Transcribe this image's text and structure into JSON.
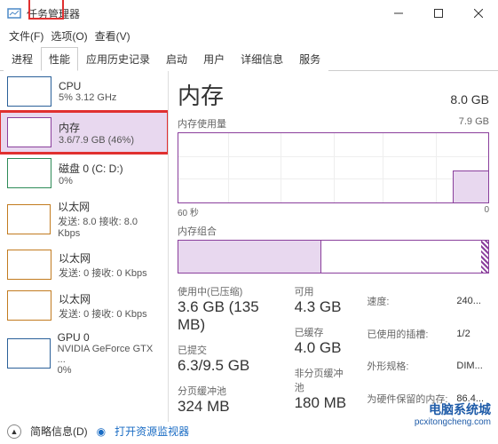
{
  "window": {
    "title": "任务管理器",
    "menu": {
      "file": "文件(F)",
      "options": "选项(O)",
      "view": "查看(V)"
    },
    "controls": {
      "min": "–",
      "max": "□",
      "close": "×"
    }
  },
  "tabs": [
    "进程",
    "性能",
    "应用历史记录",
    "启动",
    "用户",
    "详细信息",
    "服务"
  ],
  "active_tab": 1,
  "sidebar": {
    "items": [
      {
        "name": "CPU",
        "sub": "5% 3.12 GHz",
        "color": "blue"
      },
      {
        "name": "内存",
        "sub": "3.6/7.9 GB (46%)",
        "color": "purple",
        "selected": true
      },
      {
        "name": "磁盘 0 (C: D:)",
        "sub": "0%",
        "color": "green"
      },
      {
        "name": "以太网",
        "sub": "发送: 8.0 接收: 8.0 Kbps",
        "color": "orange"
      },
      {
        "name": "以太网",
        "sub": "发送: 0 接收: 0 Kbps",
        "color": "orange"
      },
      {
        "name": "以太网",
        "sub": "发送: 0 接收: 0 Kbps",
        "color": "orange"
      },
      {
        "name": "GPU 0",
        "sub": "NVIDIA GeForce GTX ...\n0%",
        "color": "blue"
      }
    ]
  },
  "detail": {
    "title": "内存",
    "capacity": "8.0 GB",
    "usage_chart": {
      "label": "内存使用量",
      "max": "7.9 GB",
      "axis_left": "60 秒",
      "axis_right": "0"
    },
    "composition_label": "内存组合",
    "stats": {
      "in_use": {
        "label": "使用中(已压缩)",
        "value": "3.6 GB (135 MB)"
      },
      "available": {
        "label": "可用",
        "value": "4.3 GB"
      },
      "committed": {
        "label": "已提交",
        "value": "6.3/9.5 GB"
      },
      "cached": {
        "label": "已缓存",
        "value": "4.0 GB"
      },
      "paged": {
        "label": "分页缓冲池",
        "value": "324 MB"
      },
      "nonpaged": {
        "label": "非分页缓冲池",
        "value": "180 MB"
      }
    },
    "specs": {
      "speed": {
        "label": "速度:",
        "value": "240..."
      },
      "slots": {
        "label": "已使用的插槽:",
        "value": "1/2"
      },
      "form": {
        "label": "外形规格:",
        "value": "DIM..."
      },
      "reserved": {
        "label": "为硬件保留的内存:",
        "value": "86.4..."
      }
    }
  },
  "footer": {
    "fewer": "简略信息(D)",
    "monitor": "打开资源监视器"
  },
  "watermark": {
    "title": "电脑系统城",
    "url": "pcxitongcheng.com"
  },
  "chart_data": {
    "type": "area",
    "title": "内存使用量",
    "ylabel": "GB",
    "ylim": [
      0,
      7.9
    ],
    "x_range_seconds": 60,
    "series": [
      {
        "name": "使用中",
        "approx_current_gb": 3.6,
        "approx_percent": 46
      }
    ],
    "composition": {
      "in_use_gb": 3.6,
      "total_gb": 7.9,
      "percent": 46
    }
  }
}
